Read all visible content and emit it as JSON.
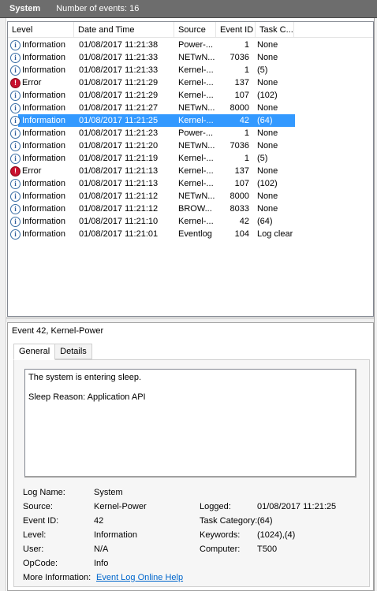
{
  "header": {
    "log_name": "System",
    "event_count": "Number of events: 16"
  },
  "columns": [
    "Level",
    "Date and Time",
    "Source",
    "Event ID",
    "Task C..."
  ],
  "events": [
    {
      "level": "Information",
      "icon": "info-icon",
      "datetime": "01/08/2017 11:21:38",
      "source": "Power-...",
      "event_id": "1",
      "task": "None"
    },
    {
      "level": "Information",
      "icon": "info-icon",
      "datetime": "01/08/2017 11:21:33",
      "source": "NETwN...",
      "event_id": "7036",
      "task": "None"
    },
    {
      "level": "Information",
      "icon": "info-icon",
      "datetime": "01/08/2017 11:21:33",
      "source": "Kernel-...",
      "event_id": "1",
      "task": "(5)"
    },
    {
      "level": "Error",
      "icon": "error-icon",
      "datetime": "01/08/2017 11:21:29",
      "source": "Kernel-...",
      "event_id": "137",
      "task": "None"
    },
    {
      "level": "Information",
      "icon": "info-icon",
      "datetime": "01/08/2017 11:21:29",
      "source": "Kernel-...",
      "event_id": "107",
      "task": "(102)"
    },
    {
      "level": "Information",
      "icon": "info-icon",
      "datetime": "01/08/2017 11:21:27",
      "source": "NETwN...",
      "event_id": "8000",
      "task": "None"
    },
    {
      "level": "Information",
      "icon": "info-icon",
      "datetime": "01/08/2017 11:21:25",
      "source": "Kernel-...",
      "event_id": "42",
      "task": "(64)",
      "selected": true
    },
    {
      "level": "Information",
      "icon": "info-icon",
      "datetime": "01/08/2017 11:21:23",
      "source": "Power-...",
      "event_id": "1",
      "task": "None"
    },
    {
      "level": "Information",
      "icon": "info-icon",
      "datetime": "01/08/2017 11:21:20",
      "source": "NETwN...",
      "event_id": "7036",
      "task": "None"
    },
    {
      "level": "Information",
      "icon": "info-icon",
      "datetime": "01/08/2017 11:21:19",
      "source": "Kernel-...",
      "event_id": "1",
      "task": "(5)"
    },
    {
      "level": "Error",
      "icon": "error-icon",
      "datetime": "01/08/2017 11:21:13",
      "source": "Kernel-...",
      "event_id": "137",
      "task": "None"
    },
    {
      "level": "Information",
      "icon": "info-icon",
      "datetime": "01/08/2017 11:21:13",
      "source": "Kernel-...",
      "event_id": "107",
      "task": "(102)"
    },
    {
      "level": "Information",
      "icon": "info-icon",
      "datetime": "01/08/2017 11:21:12",
      "source": "NETwN...",
      "event_id": "8000",
      "task": "None"
    },
    {
      "level": "Information",
      "icon": "info-icon",
      "datetime": "01/08/2017 11:21:12",
      "source": "BROW...",
      "event_id": "8033",
      "task": "None"
    },
    {
      "level": "Information",
      "icon": "info-icon",
      "datetime": "01/08/2017 11:21:10",
      "source": "Kernel-...",
      "event_id": "42",
      "task": "(64)"
    },
    {
      "level": "Information",
      "icon": "info-icon",
      "datetime": "01/08/2017 11:21:01",
      "source": "Eventlog",
      "event_id": "104",
      "task": "Log clear"
    }
  ],
  "detail": {
    "title": "Event 42, Kernel-Power",
    "tabs": [
      "General",
      "Details"
    ],
    "active_tab": "General",
    "message_line1": "The system is entering sleep.",
    "message_line2": "Sleep Reason: Application API",
    "props": {
      "log_name_label": "Log Name:",
      "log_name": "System",
      "source_label": "Source:",
      "source": "Kernel-Power",
      "logged_label": "Logged:",
      "logged": "01/08/2017 11:21:25",
      "event_id_label": "Event ID:",
      "event_id": "42",
      "task_category_label": "Task Category:",
      "task_category": "(64)",
      "level_label": "Level:",
      "level": "Information",
      "keywords_label": "Keywords:",
      "keywords": "(1024),(4)",
      "user_label": "User:",
      "user": "N/A",
      "computer_label": "Computer:",
      "computer": "T500",
      "opcode_label": "OpCode:",
      "opcode": "Info",
      "more_info_label": "More Information:",
      "more_info_link": "Event Log Online Help"
    }
  },
  "colors": {
    "titlebar": "#6d6d6d",
    "selection": "#3399ff",
    "error": "#c8102e",
    "link": "#0066cc"
  }
}
